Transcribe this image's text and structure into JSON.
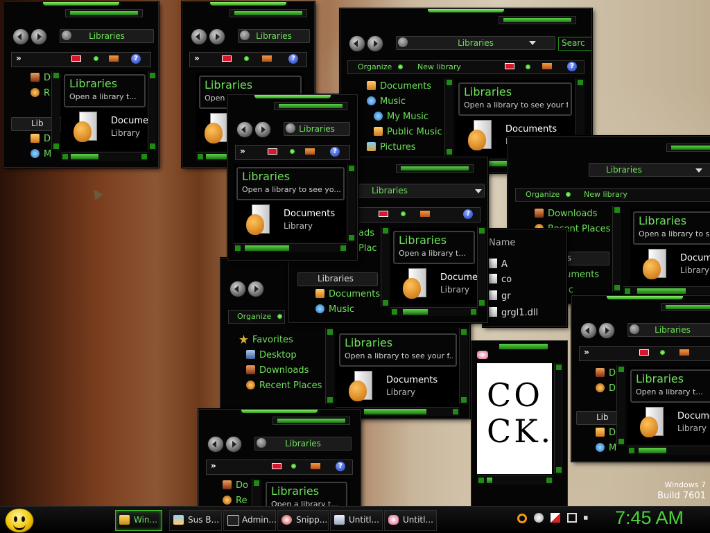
{
  "common": {
    "libraries": "Libraries",
    "open_library": "Open a library to see your files",
    "open_library_trunc1": "Open a library t...",
    "open_library_trunc2": "Open a library to see yo...",
    "open_library_trunc3": "Open a library to see your f...",
    "open_library_trunc4": "Open a library to see y",
    "documents": "Documents",
    "documents_trunc": "Docume",
    "library": "Library",
    "organize": "Organize",
    "new_library": "New library",
    "search": "Search",
    "search_trunc": "Searc",
    "help": "?",
    "chevron": "»"
  },
  "nav": {
    "documents": "Documents",
    "music": "Music",
    "my_music": "My Music",
    "public_music": "Public Music",
    "pictures": "Pictures",
    "favorites": "Favorites",
    "desktop": "Desktop",
    "downloads": "Downloads",
    "recent_places": "Recent Places",
    "lib_trunc": "Lib",
    "do_trunc": "Do",
    "re_trunc": "Re",
    "d_trunc": "D",
    "r_trunc": "R",
    "m_trunc": "M",
    "ads_trunc": "ads",
    "plac_trunc": "Plac"
  },
  "files": {
    "header": "Name",
    "items": [
      "A",
      "co",
      "gr",
      "grgl1.dll"
    ]
  },
  "paint": {
    "sketch_line1": "CO",
    "sketch_line2": "CK."
  },
  "watermark": {
    "os": "Windows 7",
    "build": "Build 7601"
  },
  "taskbar": {
    "items": [
      {
        "label": "Win...",
        "active": true
      },
      {
        "label": "Sus B..."
      },
      {
        "label": "Admin..."
      },
      {
        "label": "Snipp..."
      },
      {
        "label": "Untitl..."
      },
      {
        "label": "Untitl..."
      }
    ],
    "clock": "7:45 AM"
  },
  "colors": {
    "accent": "#6ee05a",
    "window_bg": "#050505"
  }
}
